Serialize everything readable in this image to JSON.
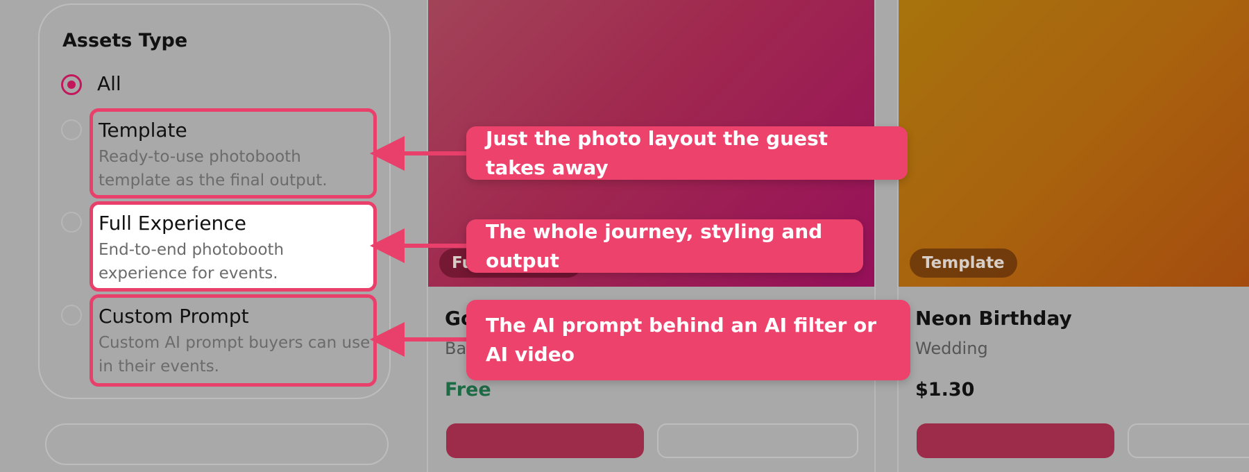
{
  "filter": {
    "title": "Assets Type",
    "options": [
      {
        "label": "All",
        "checked": true
      },
      {
        "label": "Template",
        "desc": "Ready-to-use photobooth template as the final output."
      },
      {
        "label": "Full Experience",
        "desc": "End-to-end photobooth experience for events."
      },
      {
        "label": "Custom Prompt",
        "desc": "Custom AI prompt buyers can use in their events."
      }
    ]
  },
  "cards": [
    {
      "badge": "Fu",
      "title": "Go",
      "subtitle": "Ba",
      "price": "Free"
    },
    {
      "badge": "Template",
      "title": "Neon Birthday",
      "subtitle": "Wedding",
      "price": "$1.30"
    }
  ],
  "callouts": {
    "template": "Just the photo layout the guest takes away",
    "full_experience": "The whole journey, styling and output",
    "custom_prompt": "The AI prompt behind an AI filter or AI video"
  },
  "colors": {
    "accent": "#e8406b",
    "radio_checked": "#c2185b",
    "free_price": "#1d6b45"
  }
}
